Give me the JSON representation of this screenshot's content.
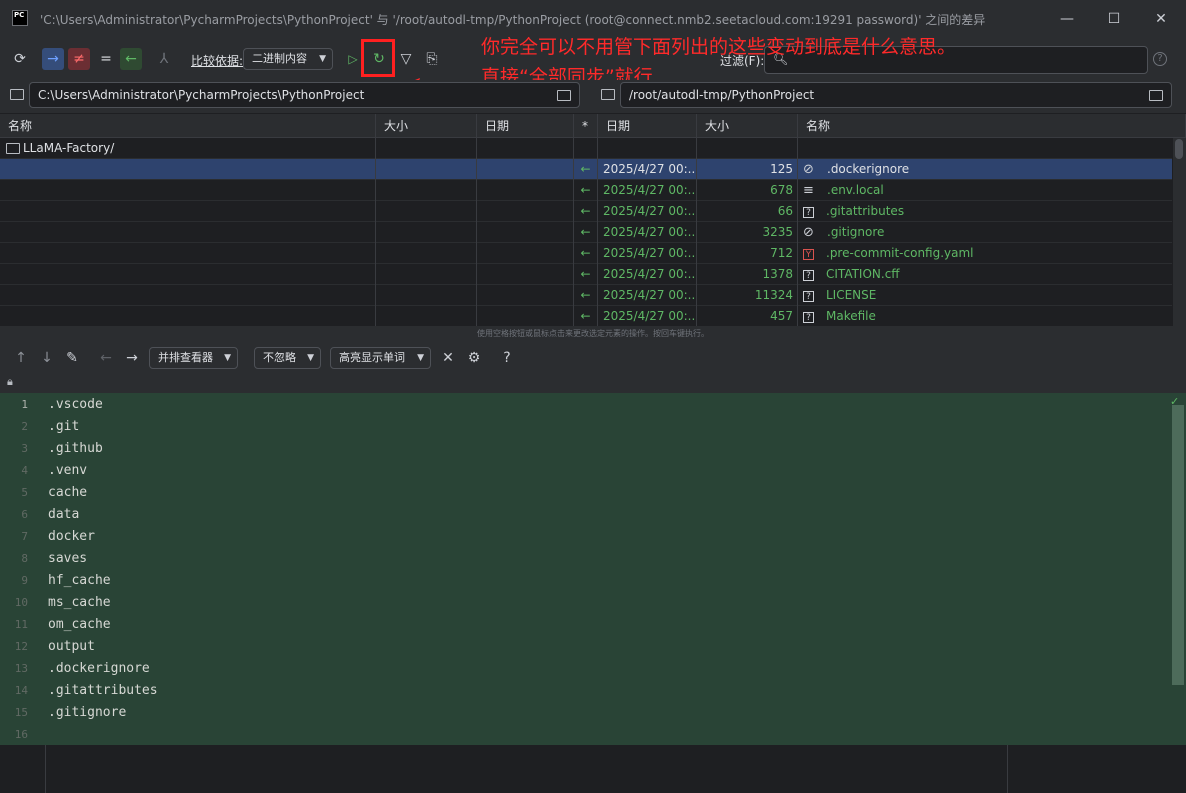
{
  "app": {
    "icon_text": "PC",
    "title": "'C:\\Users\\Administrator\\PycharmProjects\\PythonProject' 与 '/root/autodl-tmp/PythonProject (root@connect.nmb2.seetacloud.com:19291 password)' 之间的差异"
  },
  "window_controls": {
    "minimize": "—",
    "maximize": "☐",
    "close": "✕"
  },
  "toolbar": {
    "compare_by_label": "比较依据:",
    "compare_by_value": "二进制内容",
    "filter_label": "过滤(F):",
    "help": "?"
  },
  "annotation": {
    "line1": "你完全可以不用管下面列出的这些变动到底是什么意思。",
    "line2": "直接“全部同步”就行"
  },
  "paths": {
    "left": "C:\\Users\\Administrator\\PycharmProjects\\PythonProject",
    "right": "/root/autodl-tmp/PythonProject"
  },
  "table": {
    "headers": {
      "left_name": "名称",
      "left_size": "大小",
      "left_date": "日期",
      "sync": "*",
      "right_date": "日期",
      "right_size": "大小",
      "right_name": "名称"
    },
    "folder_row": "LLaMA-Factory/",
    "rows": [
      {
        "sync": "←",
        "date": "2025/4/27 00:...",
        "size": "125",
        "name": ".dockerignore",
        "icon": "ignore-icon"
      },
      {
        "sync": "←",
        "date": "2025/4/27 00:...",
        "size": "678",
        "name": ".env.local",
        "icon": "text-lines-icon"
      },
      {
        "sync": "←",
        "date": "2025/4/27 00:...",
        "size": "66",
        "name": ".gitattributes",
        "icon": "unknown-file-icon"
      },
      {
        "sync": "←",
        "date": "2025/4/27 00:...",
        "size": "3235",
        "name": ".gitignore",
        "icon": "ignore-icon"
      },
      {
        "sync": "←",
        "date": "2025/4/27 00:...",
        "size": "712",
        "name": ".pre-commit-config.yaml",
        "icon": "yaml-icon"
      },
      {
        "sync": "←",
        "date": "2025/4/27 00:...",
        "size": "1378",
        "name": "CITATION.cff",
        "icon": "unknown-file-icon"
      },
      {
        "sync": "←",
        "date": "2025/4/27 00:...",
        "size": "11324",
        "name": "LICENSE",
        "icon": "unknown-file-icon"
      },
      {
        "sync": "←",
        "date": "2025/4/27 00:...",
        "size": "457",
        "name": "Makefile",
        "icon": "unknown-file-icon"
      }
    ]
  },
  "hint": "使用空格按钮或鼠标点击来更改选定元素的操作。按回车键执行。",
  "diff_toolbar": {
    "viewer": "并排查看器",
    "ignore": "不忽略",
    "highlight": "高亮显示单词",
    "help": "?"
  },
  "editor": {
    "lines": [
      ".vscode",
      ".git",
      ".github",
      ".venv",
      "cache",
      "data",
      "docker",
      "saves",
      "hf_cache",
      "ms_cache",
      "om_cache",
      "output",
      ".dockerignore",
      ".gitattributes",
      ".gitignore",
      ""
    ],
    "check": "✓"
  },
  "colors": {
    "accent_green": "#5fb865",
    "selection": "#2e436e",
    "annotation_red": "#ff2020",
    "editor_bg": "#294436"
  }
}
